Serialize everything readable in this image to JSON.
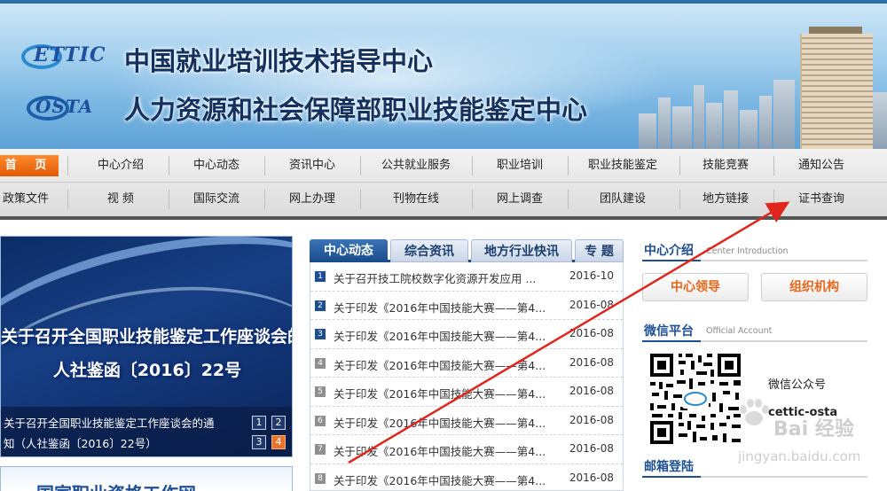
{
  "banner": {
    "logo_ettic": "ETTIC",
    "logo_osta": "OSTA",
    "title_1": "中国就业培训技术指导中心",
    "title_2": "人力资源和社会保障部职业技能鉴定中心"
  },
  "nav": {
    "home": "首  页",
    "row1": [
      "中心介绍",
      "中心动态",
      "资讯中心",
      "公共就业服务",
      "职业培训",
      "职业技能鉴定",
      "技能竞赛",
      "通知公告"
    ],
    "row2": [
      "政策文件",
      "视    频",
      "国际交流",
      "网上办理",
      "刊物在线",
      "网上调查",
      "团队建设",
      "地方链接",
      "证书查询"
    ]
  },
  "slideshow": {
    "headline_1": "关于召开全国职业技能鉴定工作座谈会的通知",
    "headline_2": "人社鉴函〔2016〕22号",
    "caption_1": "关于召开全国职业技能鉴定工作座谈会的通",
    "caption_2": "知（人社鉴函〔2016〕22号）",
    "pages": [
      "1",
      "2",
      "3",
      "4"
    ],
    "active_page": "4",
    "below_text": "国家职业资格工作网"
  },
  "news": {
    "tabs": [
      "中心动态",
      "综合资讯",
      "地方行业快讯",
      "专  题"
    ],
    "active_tab": "中心动态",
    "items": [
      {
        "num": "1",
        "title": "关于召开技工院校数字化资源开发应用 ...",
        "date": "2016-10"
      },
      {
        "num": "2",
        "title": "关于印发《2016年中国技能大赛——第4...",
        "date": "2016-08"
      },
      {
        "num": "3",
        "title": "关于印发《2016年中国技能大赛——第4...",
        "date": "2016-08"
      },
      {
        "num": "4",
        "title": "关于印发《2016年中国技能大赛——第4...",
        "date": "2016-08"
      },
      {
        "num": "5",
        "title": "关于印发《2016年中国技能大赛——第4...",
        "date": "2016-08"
      },
      {
        "num": "6",
        "title": "关于印发《2016年中国技能大赛——第4...",
        "date": "2016-08"
      },
      {
        "num": "7",
        "title": "关于印发《2016年中国技能大赛——第4...",
        "date": "2016-08"
      },
      {
        "num": "8",
        "title": "关于印发《2016年中国技能大赛——第4...",
        "date": "2016-08"
      }
    ]
  },
  "right": {
    "intro_title": "中心介绍",
    "intro_sub": "Center Introduction",
    "btn_leaders": "中心领导",
    "btn_org": "组织机构",
    "wechat_title": "微信平台",
    "wechat_sub": "Official Account",
    "wechat_label": "微信公众号",
    "wechat_id": "cettic-osta",
    "mail_title": "邮箱登陆"
  },
  "watermark": {
    "brand": "Bai 经验",
    "url": "jingyan.baidu.com"
  },
  "colors": {
    "accent_orange": "#e8661a",
    "brand_blue": "#1d4f95",
    "annotation_red": "#e0261c"
  }
}
